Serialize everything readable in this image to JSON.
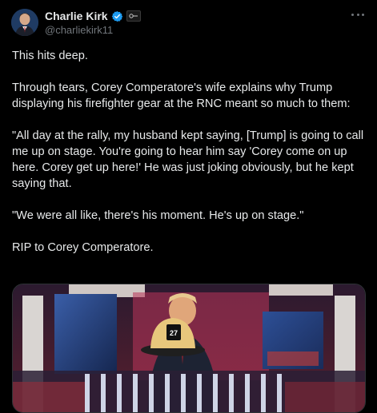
{
  "author": {
    "display_name": "Charlie Kirk",
    "handle": "@charliekirk11",
    "verified_icon": "verified-badge-icon",
    "affiliate_icon": "affiliate-badge-icon"
  },
  "menu_icon": "more-dots-icon",
  "tweet": {
    "paragraphs": [
      "This hits deep.",
      "Through tears, Corey Comperatore's wife explains why Trump displaying his firefighter gear at the RNC meant so much to them:",
      "\"All day at the rally, my husband kept saying, [Trump] is going to call me up on stage. You're going to hear him say 'Corey come on up here. Corey get up here!' He was just joking obviously, but he kept saying that.",
      "\"We were all like, there's his moment. He's up on stage.\"",
      "RIP to Corey Comperatore."
    ]
  },
  "media": {
    "helmet_number": "27",
    "description_icon": "video-still-image"
  },
  "colors": {
    "background": "#000000",
    "text": "#e7e9ea",
    "secondary_text": "#71767b",
    "verified_blue": "#1d9bf0"
  }
}
